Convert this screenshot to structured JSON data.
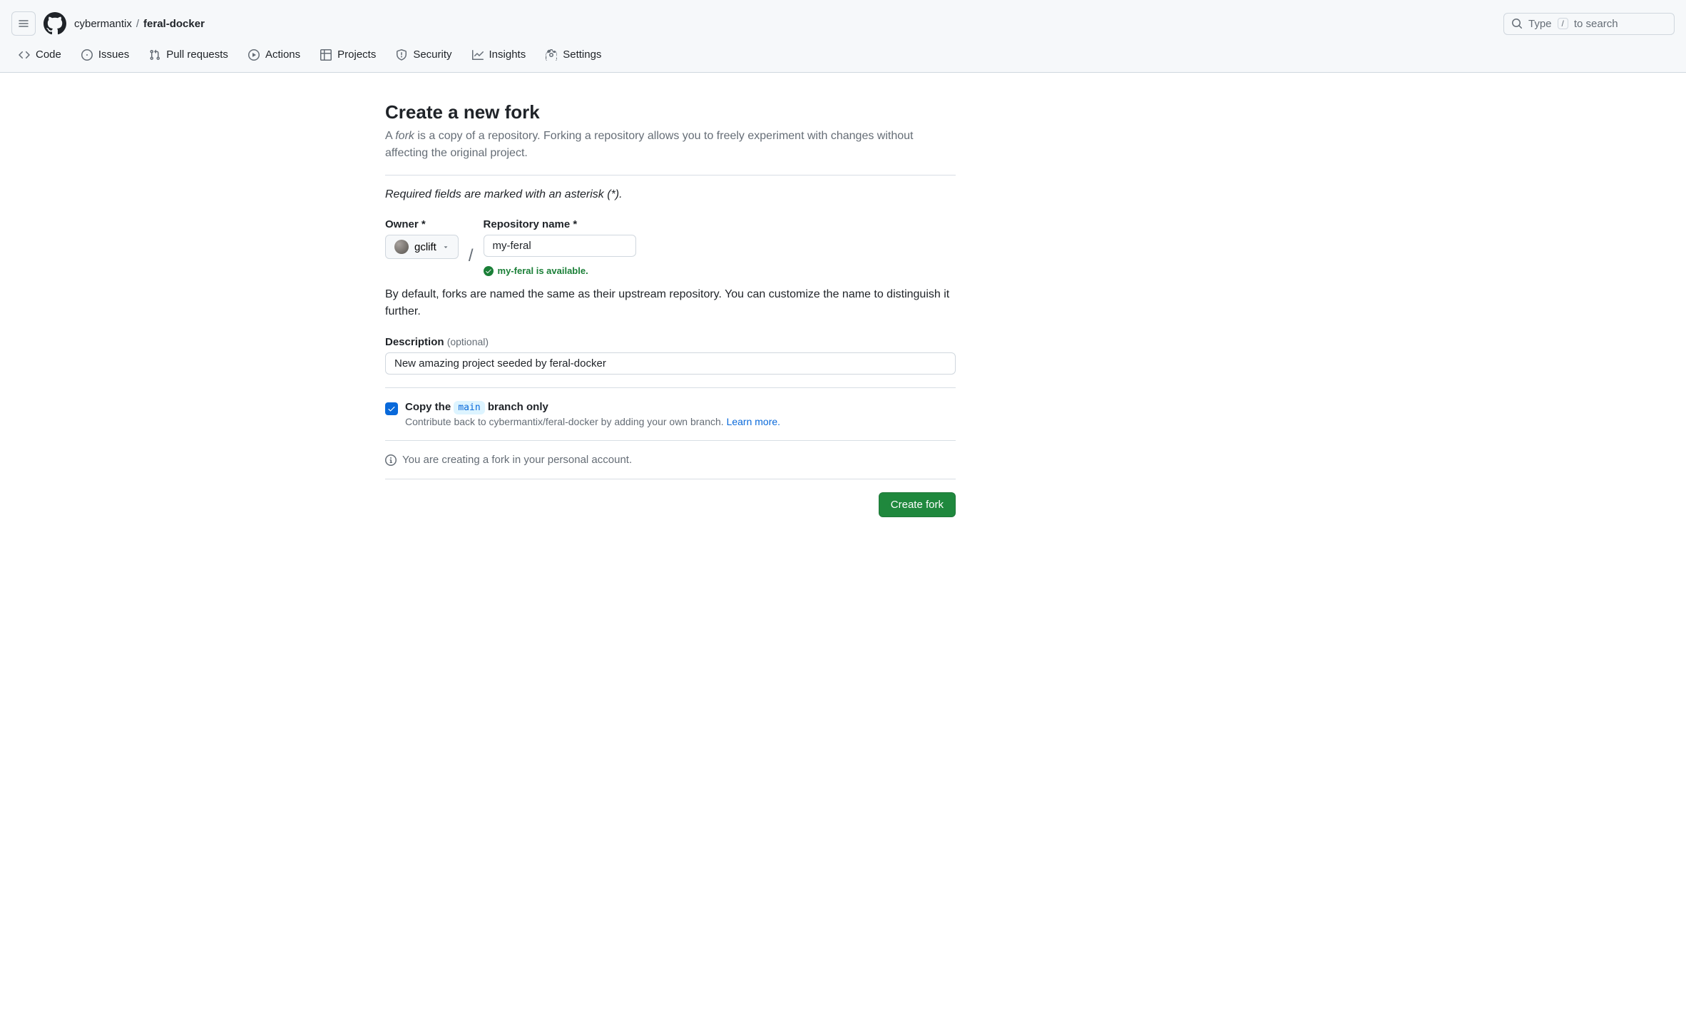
{
  "header": {
    "owner": "cybermantix",
    "repo": "feral-docker",
    "search_prefix": "Type",
    "search_kbd": "/",
    "search_suffix": "to search"
  },
  "nav": {
    "code": "Code",
    "issues": "Issues",
    "pulls": "Pull requests",
    "actions": "Actions",
    "projects": "Projects",
    "security": "Security",
    "insights": "Insights",
    "settings": "Settings"
  },
  "page": {
    "title": "Create a new fork",
    "lead_prefix": "A ",
    "lead_em": "fork",
    "lead_rest": " is a copy of a repository. Forking a repository allows you to freely experiment with changes without affecting the original project.",
    "required_note": "Required fields are marked with an asterisk (*).",
    "owner_label": "Owner *",
    "owner_value": "gclift",
    "repo_label": "Repository name *",
    "repo_value": "my-feral",
    "avail_text": "my-feral is available.",
    "name_helper": "By default, forks are named the same as their upstream repository. You can customize the name to distinguish it further.",
    "desc_label": "Description",
    "desc_optional": "(optional)",
    "desc_value": "New amazing project seeded by feral-docker",
    "copy_prefix": "Copy the",
    "copy_branch": "main",
    "copy_suffix": "branch only",
    "contribute_text": "Contribute back to cybermantix/feral-docker by adding your own branch. ",
    "learn_more": "Learn more.",
    "info_text": "You are creating a fork in your personal account.",
    "submit": "Create fork"
  }
}
